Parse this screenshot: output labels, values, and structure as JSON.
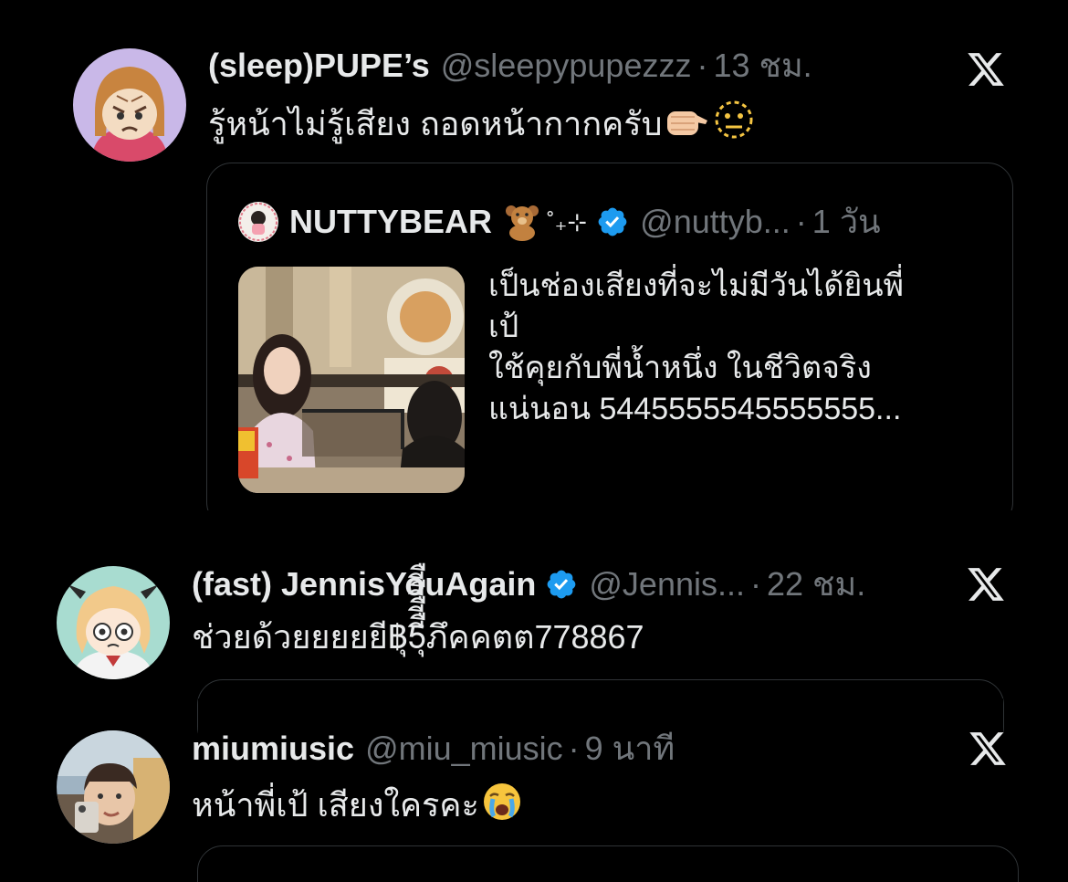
{
  "tweets": [
    {
      "name": "(sleep)PUPE’s",
      "handle": "@sleepypupezzz",
      "separator": "·",
      "time": "13 ชม.",
      "text": "รู้หน้าไม่รู้เสียง ถอดหน้ากากครับ",
      "emojis": [
        "fist-emoji",
        "dotted-face-emoji"
      ],
      "quote": {
        "name": "NUTTYBEAR",
        "emoji": "teddy-bear-emoji",
        "sparkle": "˚₊⊹",
        "verified": true,
        "handle": "@nuttyb...",
        "separator": "·",
        "time": "1 วัน",
        "text_lines": [
          "เป็นช่องเสียงที่จะไม่มีวันได้ยินพี่",
          "เป้",
          "ใช้คุยกับพี่น้ำหนึ่ง ในชีวิตจริง",
          "แน่นอน 5445555545555555..."
        ]
      }
    },
    {
      "name": "(fast) JennisYouAgain",
      "verified": true,
      "handle": "@Jennis...",
      "separator": "·",
      "time": "22 ชม.",
      "text": "ช่วยด้วยยยยยี฿ุ5ีืีืีืีืุภึคคตต778867"
    },
    {
      "name": "miumiusic",
      "handle": "@miu_miusic",
      "separator": "·",
      "time": "9 นาที",
      "text": "หน้าพี่เป้ เสียงใครคะ",
      "emojis": [
        "crying-face-emoji"
      ]
    }
  ],
  "colors": {
    "background": "#000000",
    "text": "#e7e9ea",
    "secondary": "#71767b",
    "verified": "#1d9bf0",
    "border": "#2f3336"
  }
}
